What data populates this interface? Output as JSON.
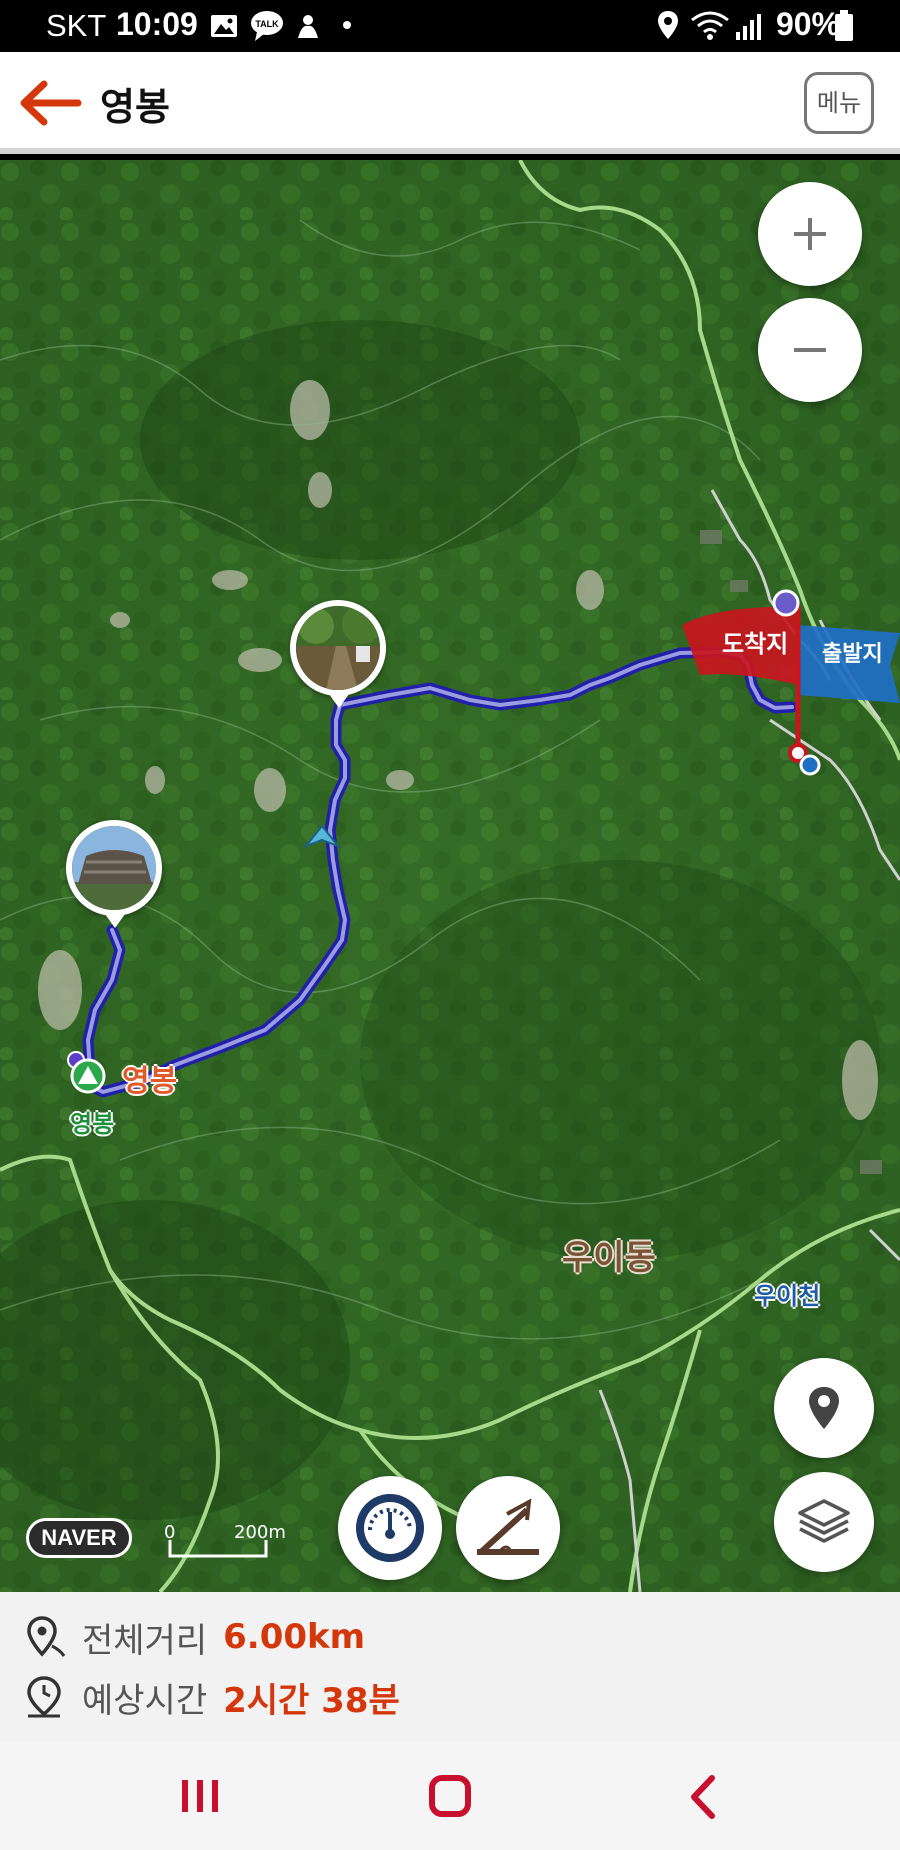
{
  "status_bar": {
    "carrier": "SKT",
    "time": "10:09",
    "battery": "90%",
    "icons": [
      "gallery-icon",
      "talk-icon",
      "app-icon",
      "dot-icon",
      "location-icon",
      "wifi-icon",
      "signal-icon",
      "battery-icon"
    ],
    "talk_icon_text": "TALK"
  },
  "header": {
    "title": "영봉",
    "menu_label": "메뉴",
    "accent": "#d4370b"
  },
  "map": {
    "labels": {
      "summit_route": "영봉",
      "summit_place": "영봉",
      "district": "우이동",
      "stream": "우이천",
      "arrival": "도착지",
      "departure": "출발지",
      "scale_zero": "0",
      "scale_dist": "200m",
      "provider": "NAVER"
    },
    "route_color": "#2d2dbb",
    "trail_color": "#a6d98a",
    "arrival_color": "#c8161d",
    "departure_color": "#1f6fc5"
  },
  "info": {
    "distance_label": "전체거리",
    "distance_value": "6.00km",
    "time_label": "예상시간",
    "time_value": "2시간 38분"
  }
}
